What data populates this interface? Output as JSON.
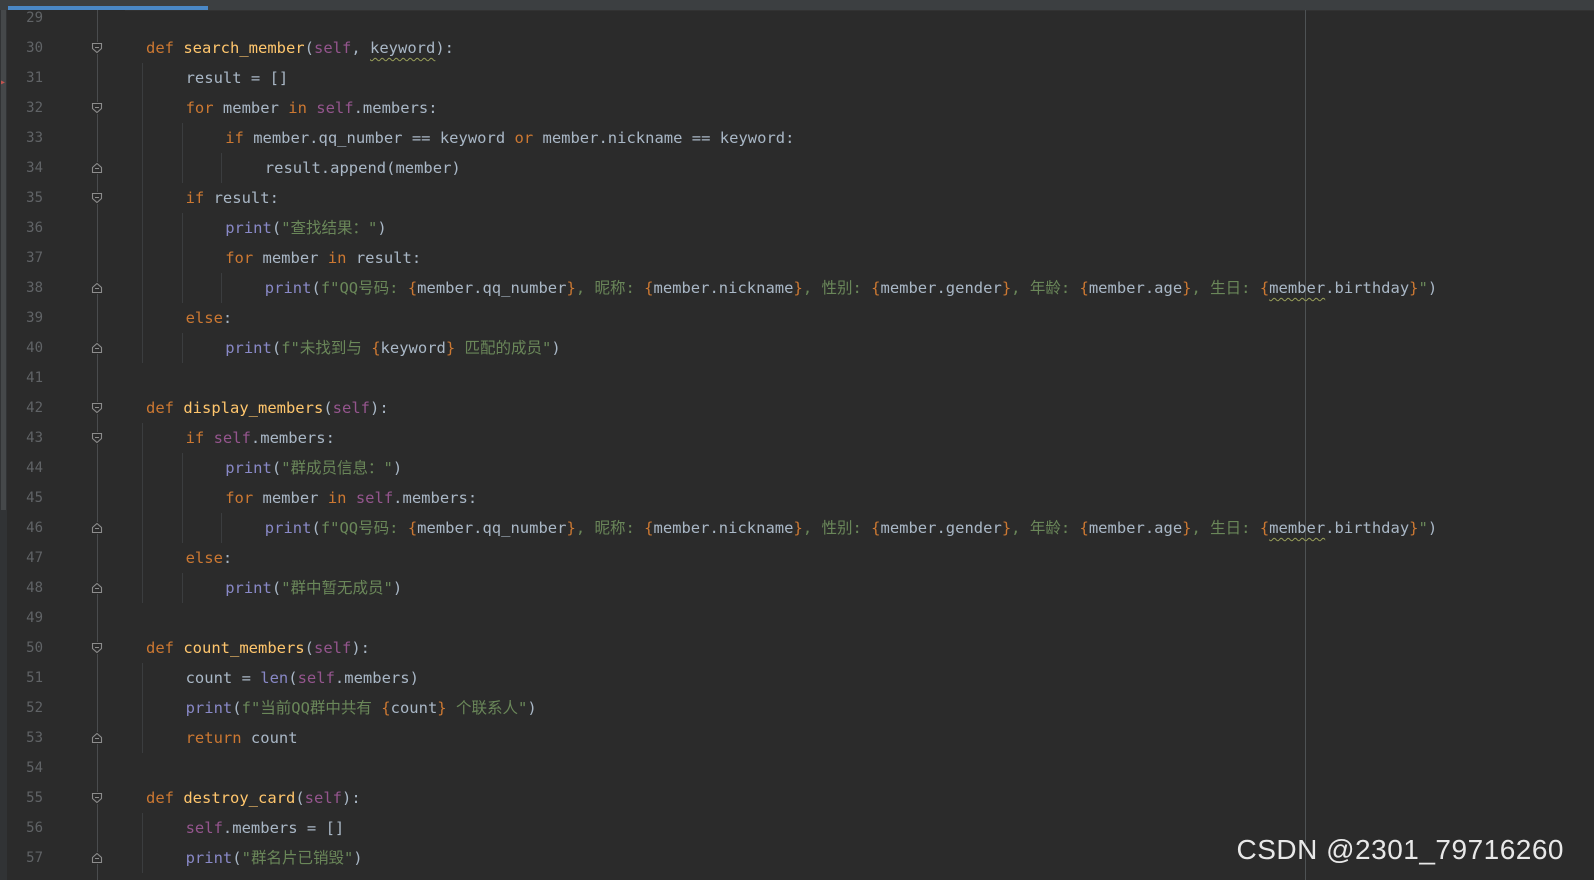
{
  "editor": {
    "first_line": 29,
    "lines": [
      {
        "n": "29",
        "indent": 0,
        "fold": "",
        "tokens": []
      },
      {
        "n": "30",
        "indent": 0,
        "fold": "open",
        "tokens": [
          [
            "kw",
            "def "
          ],
          [
            "fn",
            "search_member"
          ],
          [
            "",
            "("
          ],
          [
            "slf",
            "self"
          ],
          [
            "",
            ", "
          ],
          [
            "wavy",
            "keyword"
          ],
          [
            "",
            "):"
          ]
        ]
      },
      {
        "n": "31",
        "indent": 1,
        "fold": "",
        "tokens": [
          [
            "",
            "result = []"
          ]
        ]
      },
      {
        "n": "32",
        "indent": 1,
        "fold": "open",
        "tokens": [
          [
            "kw",
            "for "
          ],
          [
            "",
            "member "
          ],
          [
            "kw",
            "in "
          ],
          [
            "slf",
            "self"
          ],
          [
            "",
            ".members:"
          ]
        ]
      },
      {
        "n": "33",
        "indent": 2,
        "fold": "",
        "tokens": [
          [
            "kw",
            "if "
          ],
          [
            "",
            "member.qq_number == keyword "
          ],
          [
            "kw",
            "or "
          ],
          [
            "",
            "member.nickname == keyword:"
          ]
        ]
      },
      {
        "n": "34",
        "indent": 3,
        "fold": "close",
        "tokens": [
          [
            "",
            "result.append(member)"
          ]
        ]
      },
      {
        "n": "35",
        "indent": 1,
        "fold": "open",
        "tokens": [
          [
            "kw",
            "if "
          ],
          [
            "",
            "result:"
          ]
        ]
      },
      {
        "n": "36",
        "indent": 2,
        "fold": "",
        "tokens": [
          [
            "bi",
            "print"
          ],
          [
            "",
            "("
          ],
          [
            "str",
            "\"查找结果：\""
          ],
          [
            "",
            ")"
          ]
        ]
      },
      {
        "n": "37",
        "indent": 2,
        "fold": "",
        "tokens": [
          [
            "kw",
            "for "
          ],
          [
            "",
            "member "
          ],
          [
            "kw",
            "in "
          ],
          [
            "",
            "result:"
          ]
        ]
      },
      {
        "n": "38",
        "indent": 3,
        "fold": "close",
        "tokens": [
          [
            "bi",
            "print"
          ],
          [
            "",
            "("
          ],
          [
            "str",
            "f\"QQ号码: "
          ],
          [
            "br",
            "{"
          ],
          [
            "",
            "member.qq_number"
          ],
          [
            "br",
            "}"
          ],
          [
            "str",
            ", 昵称: "
          ],
          [
            "br",
            "{"
          ],
          [
            "",
            "member.nickname"
          ],
          [
            "br",
            "}"
          ],
          [
            "str",
            ", 性别: "
          ],
          [
            "br",
            "{"
          ],
          [
            "",
            "member.gender"
          ],
          [
            "br",
            "}"
          ],
          [
            "str",
            ", 年龄: "
          ],
          [
            "br",
            "{"
          ],
          [
            "",
            "member.age"
          ],
          [
            "br",
            "}"
          ],
          [
            "str",
            ", 生日: "
          ],
          [
            "br",
            "{"
          ],
          [
            "wavy",
            "member"
          ],
          [
            "",
            ".birthday"
          ],
          [
            "br",
            "}"
          ],
          [
            "str",
            "\""
          ],
          [
            "",
            ")"
          ]
        ]
      },
      {
        "n": "39",
        "indent": 1,
        "fold": "",
        "tokens": [
          [
            "kw",
            "else"
          ],
          [
            "",
            ":"
          ]
        ]
      },
      {
        "n": "40",
        "indent": 2,
        "fold": "close",
        "tokens": [
          [
            "bi",
            "print"
          ],
          [
            "",
            "("
          ],
          [
            "str",
            "f\"未找到与 "
          ],
          [
            "br",
            "{"
          ],
          [
            "",
            "keyword"
          ],
          [
            "br",
            "}"
          ],
          [
            "str",
            " 匹配的成员\""
          ],
          [
            "",
            ")"
          ]
        ]
      },
      {
        "n": "41",
        "indent": 0,
        "fold": "",
        "tokens": []
      },
      {
        "n": "42",
        "indent": 0,
        "fold": "open",
        "tokens": [
          [
            "kw",
            "def "
          ],
          [
            "fn",
            "display_members"
          ],
          [
            "",
            "("
          ],
          [
            "slf",
            "self"
          ],
          [
            "",
            "):"
          ]
        ]
      },
      {
        "n": "43",
        "indent": 1,
        "fold": "open",
        "tokens": [
          [
            "kw",
            "if "
          ],
          [
            "slf",
            "self"
          ],
          [
            "",
            ".members:"
          ]
        ]
      },
      {
        "n": "44",
        "indent": 2,
        "fold": "",
        "tokens": [
          [
            "bi",
            "print"
          ],
          [
            "",
            "("
          ],
          [
            "str",
            "\"群成员信息：\""
          ],
          [
            "",
            ")"
          ]
        ]
      },
      {
        "n": "45",
        "indent": 2,
        "fold": "",
        "tokens": [
          [
            "kw",
            "for "
          ],
          [
            "",
            "member "
          ],
          [
            "kw",
            "in "
          ],
          [
            "slf",
            "self"
          ],
          [
            "",
            ".members:"
          ]
        ]
      },
      {
        "n": "46",
        "indent": 3,
        "fold": "close",
        "tokens": [
          [
            "bi",
            "print"
          ],
          [
            "",
            "("
          ],
          [
            "str",
            "f\"QQ号码: "
          ],
          [
            "br",
            "{"
          ],
          [
            "",
            "member.qq_number"
          ],
          [
            "br",
            "}"
          ],
          [
            "str",
            ", 昵称: "
          ],
          [
            "br",
            "{"
          ],
          [
            "",
            "member.nickname"
          ],
          [
            "br",
            "}"
          ],
          [
            "str",
            ", 性别: "
          ],
          [
            "br",
            "{"
          ],
          [
            "",
            "member.gender"
          ],
          [
            "br",
            "}"
          ],
          [
            "str",
            ", 年龄: "
          ],
          [
            "br",
            "{"
          ],
          [
            "",
            "member.age"
          ],
          [
            "br",
            "}"
          ],
          [
            "str",
            ", 生日: "
          ],
          [
            "br",
            "{"
          ],
          [
            "wavy",
            "member"
          ],
          [
            "",
            ".birthday"
          ],
          [
            "br",
            "}"
          ],
          [
            "str",
            "\""
          ],
          [
            "",
            ")"
          ]
        ]
      },
      {
        "n": "47",
        "indent": 1,
        "fold": "",
        "tokens": [
          [
            "kw",
            "else"
          ],
          [
            "",
            ":"
          ]
        ]
      },
      {
        "n": "48",
        "indent": 2,
        "fold": "close",
        "tokens": [
          [
            "bi",
            "print"
          ],
          [
            "",
            "("
          ],
          [
            "str",
            "\"群中暂无成员\""
          ],
          [
            "",
            ")"
          ]
        ]
      },
      {
        "n": "49",
        "indent": 0,
        "fold": "",
        "tokens": []
      },
      {
        "n": "50",
        "indent": 0,
        "fold": "open",
        "tokens": [
          [
            "kw",
            "def "
          ],
          [
            "fn",
            "count_members"
          ],
          [
            "",
            "("
          ],
          [
            "slf",
            "self"
          ],
          [
            "",
            "):"
          ]
        ]
      },
      {
        "n": "51",
        "indent": 1,
        "fold": "",
        "tokens": [
          [
            "",
            "count = "
          ],
          [
            "bi",
            "len"
          ],
          [
            "",
            "("
          ],
          [
            "slf",
            "self"
          ],
          [
            "",
            ".members)"
          ]
        ]
      },
      {
        "n": "52",
        "indent": 1,
        "fold": "",
        "tokens": [
          [
            "bi",
            "print"
          ],
          [
            "",
            "("
          ],
          [
            "str",
            "f\"当前QQ群中共有 "
          ],
          [
            "br",
            "{"
          ],
          [
            "",
            "count"
          ],
          [
            "br",
            "}"
          ],
          [
            "str",
            " 个联系人\""
          ],
          [
            "",
            ")"
          ]
        ]
      },
      {
        "n": "53",
        "indent": 1,
        "fold": "close",
        "tokens": [
          [
            "kw",
            "return "
          ],
          [
            "",
            "count"
          ]
        ]
      },
      {
        "n": "54",
        "indent": 0,
        "fold": "",
        "tokens": []
      },
      {
        "n": "55",
        "indent": 0,
        "fold": "open",
        "tokens": [
          [
            "kw",
            "def "
          ],
          [
            "fn",
            "destroy_card"
          ],
          [
            "",
            "("
          ],
          [
            "slf",
            "self"
          ],
          [
            "",
            "):"
          ]
        ]
      },
      {
        "n": "56",
        "indent": 1,
        "fold": "",
        "tokens": [
          [
            "slf",
            "self"
          ],
          [
            "",
            ".members = []"
          ]
        ]
      },
      {
        "n": "57",
        "indent": 1,
        "fold": "close",
        "tokens": [
          [
            "bi",
            "print"
          ],
          [
            "",
            "("
          ],
          [
            "str",
            "\"群名片已销毁\""
          ],
          [
            "",
            ")"
          ]
        ]
      }
    ]
  },
  "watermark": "CSDN @2301_79716260",
  "colors": {
    "background": "#2b2b2b",
    "keyword": "#cc7832",
    "function": "#ffc66d",
    "self": "#94558d",
    "builtin": "#8888c6",
    "string": "#6a8759",
    "text": "#a9b7c6",
    "line_number": "#606366"
  },
  "icons": {
    "fold_open": "fold-open-icon",
    "fold_close": "fold-close-icon"
  }
}
